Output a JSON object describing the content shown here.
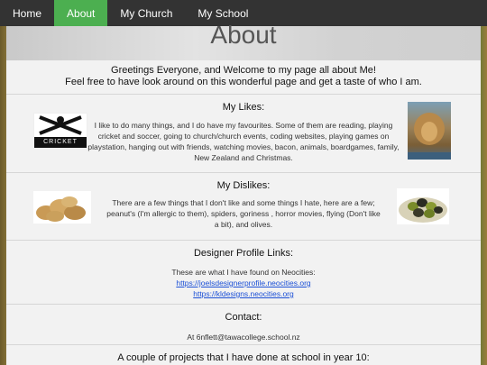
{
  "nav": {
    "items": [
      {
        "label": "Home",
        "active": false
      },
      {
        "label": "About",
        "active": true
      },
      {
        "label": "My Church",
        "active": false
      },
      {
        "label": "My School",
        "active": false
      }
    ],
    "active_color": "#4caf50",
    "bar_color": "#333333"
  },
  "hero": {
    "title": "About"
  },
  "welcome": {
    "line1": "Greetings Everyone, and Welcome to my page all about Me!",
    "line2": "Feel free to have look around on this wonderful page and get a taste of who I am."
  },
  "likes": {
    "title": "My Likes:",
    "text": "I like to do many things, and I do have my favourites. Some of them are reading, playing cricket and soccer, going to church/church events, coding websites, playing games on playstation, hanging out with friends, watching movies, bacon, animals, boardgames, family, New Zealand and Christmas.",
    "left_image_caption": "CRICKET",
    "left_image": "cricket-logo",
    "right_image": "lion-book-cover"
  },
  "dislikes": {
    "title": "My Dislikes:",
    "text": "There are a few things that I don't like and some things I hate, here are a few; peanut's (I'm allergic to them), spiders, goriness , horror movies, flying (Don't like a bit), and olives.",
    "left_image": "potatoes-photo",
    "right_image": "olives-photo"
  },
  "links": {
    "title": "Designer Profile Links:",
    "intro": "These are what I have found on Neocities:",
    "link1": "https://joelsdesignerprofile.neocities.org",
    "link2": "https://kldesigns.neocities.org"
  },
  "contact": {
    "title": "Contact:",
    "email": "At 6nflett@tawacollege.school.nz"
  },
  "projects": {
    "title": "A couple of projects that I have done at school in year 10:"
  }
}
